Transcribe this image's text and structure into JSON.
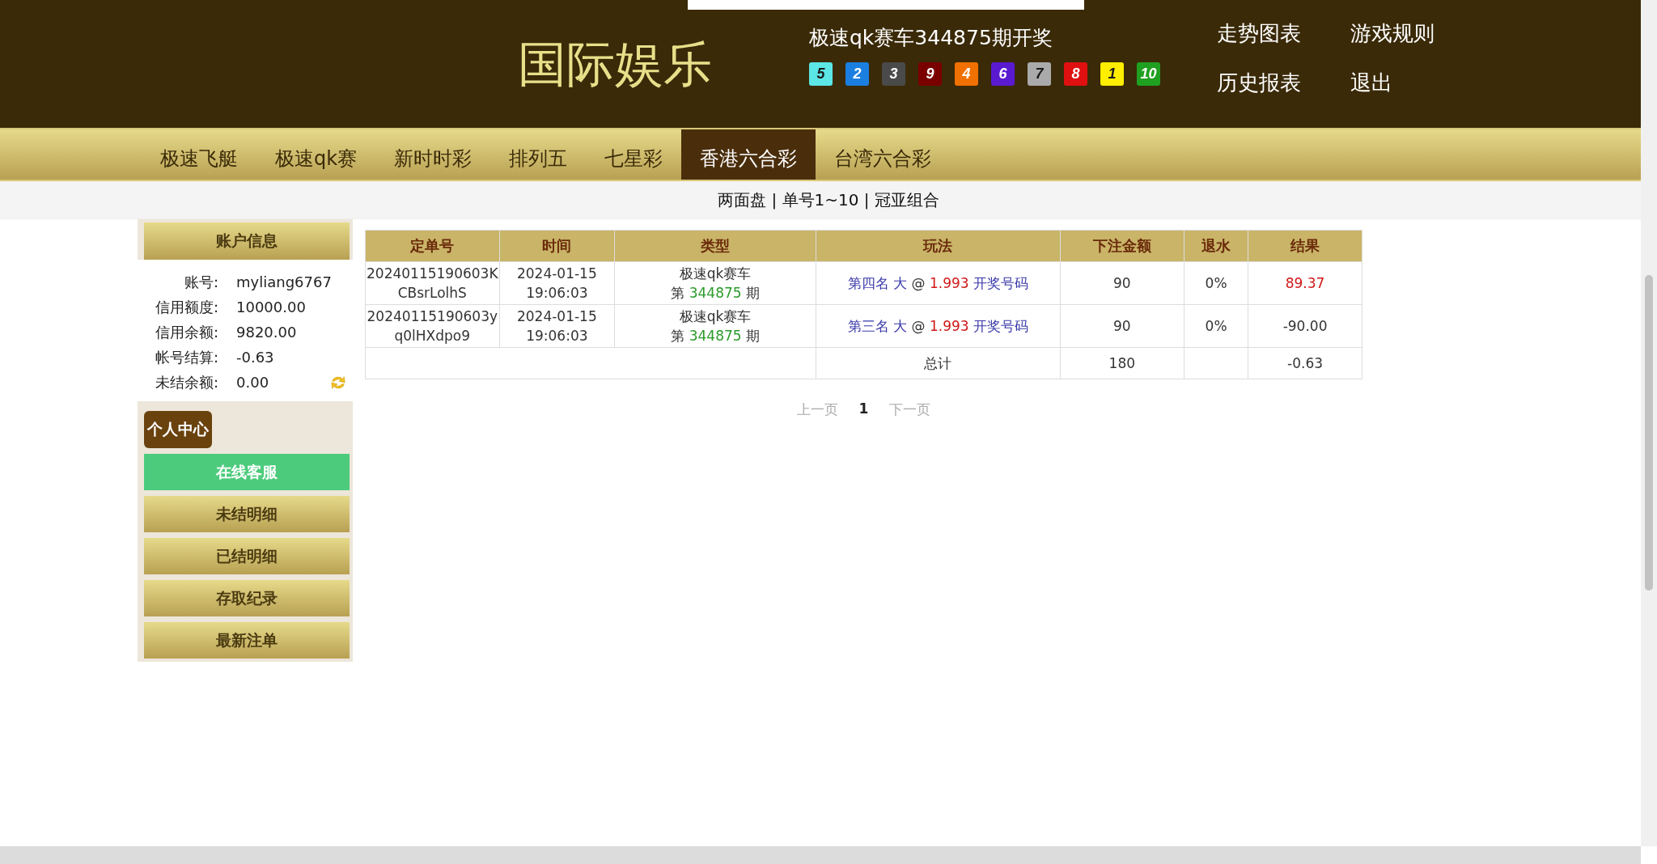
{
  "header": {
    "logo": "国际娱乐",
    "draw_title": "极速qk赛车344875期开奖",
    "balls": [
      {
        "number": "5",
        "color": "#5ce6e6"
      },
      {
        "number": "2",
        "color": "#1a7fe0"
      },
      {
        "number": "3",
        "color": "#4a4a4a"
      },
      {
        "number": "9",
        "color": "#7a0000"
      },
      {
        "number": "4",
        "color": "#f07000"
      },
      {
        "number": "6",
        "color": "#5a1ad0"
      },
      {
        "number": "7",
        "color": "#aaaaaa"
      },
      {
        "number": "8",
        "color": "#e01010"
      },
      {
        "number": "1",
        "color": "#ffee00"
      },
      {
        "number": "10",
        "color": "#20a020"
      }
    ],
    "links": [
      "走势图表",
      "游戏规则",
      "历史报表",
      "退出"
    ]
  },
  "nav_tabs": [
    {
      "label": "极速飞艇",
      "selected": false
    },
    {
      "label": "极速qk赛",
      "selected": false
    },
    {
      "label": "新时时彩",
      "selected": false
    },
    {
      "label": "排列五",
      "selected": false
    },
    {
      "label": "七星彩",
      "selected": false
    },
    {
      "label": "香港六合彩",
      "selected": true
    },
    {
      "label": "台湾六合彩",
      "selected": false
    }
  ],
  "sub_nav": "两面盘 | 单号1~10 | 冠亚组合",
  "account": {
    "title": "账户信息",
    "fields": [
      {
        "label": "账号:",
        "value": "myliang6767"
      },
      {
        "label": "信用额度:",
        "value": "10000.00"
      },
      {
        "label": "信用余额:",
        "value": "9820.00"
      },
      {
        "label": "帐号结算:",
        "value": "-0.63"
      },
      {
        "label": "未结余额:",
        "value": "0.00"
      }
    ]
  },
  "personal_center": {
    "title": "个人中心",
    "items": [
      {
        "label": "在线客服",
        "selected": true
      },
      {
        "label": "未结明细",
        "selected": false
      },
      {
        "label": "已结明细",
        "selected": false
      },
      {
        "label": "存取纪录",
        "selected": false
      },
      {
        "label": "最新注单",
        "selected": false
      }
    ]
  },
  "table": {
    "columns": [
      "定单号",
      "时间",
      "类型",
      "玩法",
      "下注金额",
      "退水",
      "结果"
    ],
    "rows": [
      {
        "order": [
          "20240115190603K",
          "CBsrLolhS"
        ],
        "time": [
          "2024-01-15",
          "19:06:03"
        ],
        "type_name": "极速qk赛车",
        "issue_prefix": "第",
        "issue": "344875",
        "issue_suffix": "期",
        "play": "第四名 大",
        "at": "@",
        "odds": "1.993",
        "draw_link": "开奖号码",
        "amount": "90",
        "rebate": "0%",
        "result": "89.37",
        "win": true
      },
      {
        "order": [
          "20240115190603y",
          "q0lHXdpo9"
        ],
        "time": [
          "2024-01-15",
          "19:06:03"
        ],
        "type_name": "极速qk赛车",
        "issue_prefix": "第",
        "issue": "344875",
        "issue_suffix": "期",
        "play": "第三名 大",
        "at": "@",
        "odds": "1.993",
        "draw_link": "开奖号码",
        "amount": "90",
        "rebate": "0%",
        "result": "-90.00",
        "win": false
      }
    ],
    "total": {
      "label": "总计",
      "amount": "180",
      "result": "-0.63"
    }
  },
  "pagination": {
    "prev": "上一页",
    "page": "1",
    "next": "下一页"
  }
}
